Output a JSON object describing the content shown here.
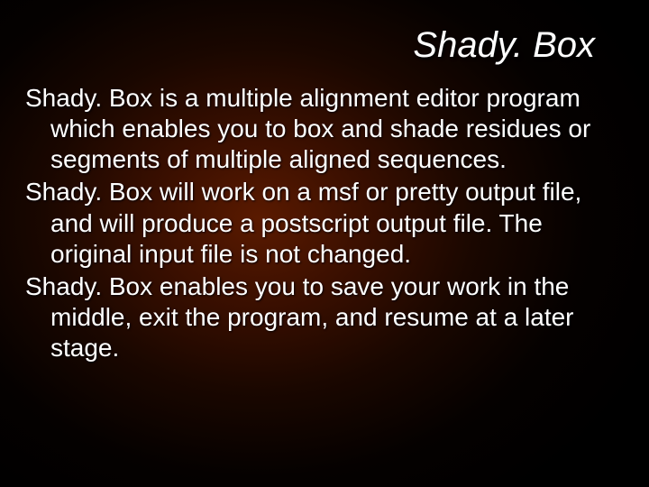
{
  "title": "Shady. Box",
  "paragraphs": [
    "Shady. Box is a multiple alignment editor program which enables you to box and shade residues or segments of multiple aligned sequences.",
    "Shady. Box will work on a msf or pretty output file, and will produce a postscript output file. The original input file is not changed.",
    "Shady. Box enables you to save your work in the middle, exit the program, and resume at a later stage."
  ]
}
